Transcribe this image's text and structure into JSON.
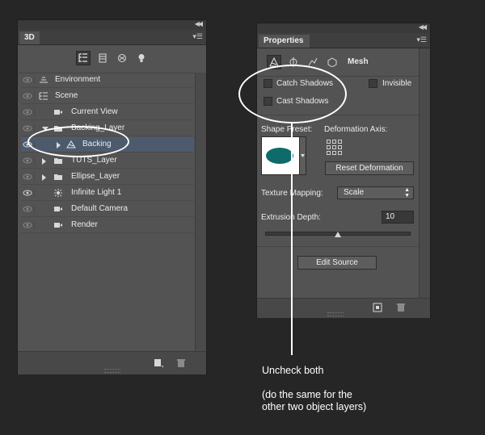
{
  "panel3d": {
    "tab": "3D",
    "layers": [
      {
        "label": "Environment",
        "indent": 0
      },
      {
        "label": "Scene",
        "indent": 0
      },
      {
        "label": "Current View",
        "indent": 1
      },
      {
        "label": "Backing_Layer",
        "indent": 1,
        "expanded": true
      },
      {
        "label": "Backing",
        "indent": 2,
        "selected": true
      },
      {
        "label": "TUTS_Layer",
        "indent": 1
      },
      {
        "label": "Ellipse_Layer",
        "indent": 1
      },
      {
        "label": "Infinite Light 1",
        "indent": 1
      },
      {
        "label": "Default Camera",
        "indent": 1
      },
      {
        "label": "Render",
        "indent": 1
      }
    ]
  },
  "properties": {
    "tab": "Properties",
    "mode_label": "Mesh",
    "catch_shadows": {
      "label": "Catch Shadows",
      "checked": false
    },
    "cast_shadows": {
      "label": "Cast Shadows",
      "checked": false
    },
    "invisible": {
      "label": "Invisible",
      "checked": false
    },
    "shape_preset_label": "Shape Preset:",
    "deformation_axis_label": "Deformation Axis:",
    "reset_deformation": "Reset Deformation",
    "texture_mapping_label": "Texture Mapping:",
    "texture_mapping_value": "Scale",
    "extrusion_depth_label": "Extrusion Depth:",
    "extrusion_depth_value": "10",
    "extrusion_slider_fraction": 0.5,
    "edit_source": "Edit Source"
  },
  "annotation": {
    "line1": "Uncheck both",
    "line2": "(do the same for the",
    "line3": "other two object layers)"
  },
  "colors": {
    "preset_swatch": "#0f6b6b",
    "highlight": "#ffffff"
  }
}
